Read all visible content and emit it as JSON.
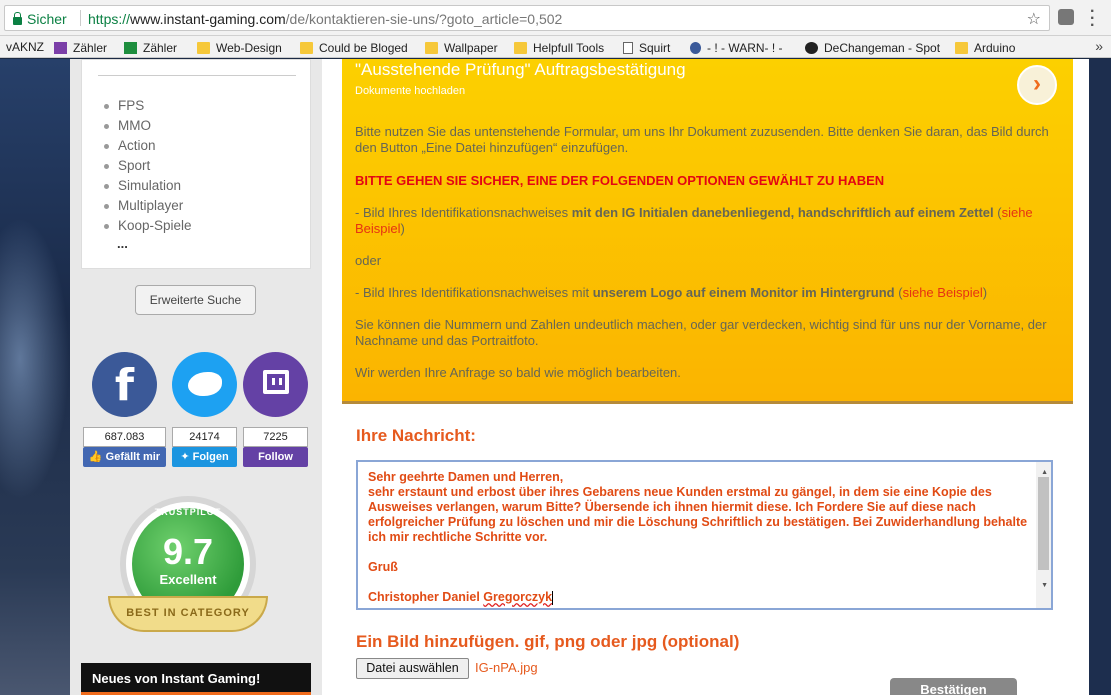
{
  "browser": {
    "secure_label": "Sicher",
    "url_scheme": "https://",
    "url_host": "www.instant-gaming.com",
    "url_path": "/de/kontaktieren-sie-uns/?goto_article=0,502",
    "bookmarks": [
      "vAKNZ",
      "Zähler",
      "Zähler",
      "Web-Design",
      "Could be Bloged",
      "Wallpaper",
      "Helpfull Tools",
      "Squirt",
      "- ! - WARN- ! -",
      "DeChangeman - Spot",
      "Arduino"
    ]
  },
  "sidebar": {
    "categories": [
      "FPS",
      "MMO",
      "Action",
      "Sport",
      "Simulation",
      "Multiplayer",
      "Koop-Spiele"
    ],
    "more": "...",
    "advanced_search": "Erweiterte Suche",
    "facebook": {
      "count": "687.083",
      "label": "Gefällt mir"
    },
    "twitter": {
      "count": "24174",
      "label": "Folgen"
    },
    "twitch": {
      "count": "7225",
      "label": "Follow"
    },
    "trustpilot": {
      "label": "TRUSTPILOT",
      "score": "9.7",
      "rating": "Excellent",
      "ribbon": "BEST IN CATEGORY"
    },
    "news": "Neues von Instant Gaming!"
  },
  "main": {
    "title": "\"Ausstehende Prüfung\" Auftragsbestätigung",
    "subtitle": "Dokumente hochladen",
    "intro": "Bitte nutzen Sie das untenstehende Formular, um uns Ihr Dokument zuzusenden. Bitte denken Sie daran, das Bild durch den Button „Eine Datei hinzufügen“ einzufügen.",
    "warning": "BITTE GEHEN SIE SICHER, EINE DER FOLGENDEN OPTIONEN GEWÄHLT ZU HABEN",
    "option1_pre": "- Bild Ihres Identifikationsnachweises ",
    "option1_bold": "mit den IG Initialen danebenliegend, handschriftlich auf einem Zettel",
    "option1_paren_open": " (",
    "option1_link": "siehe Beispiel",
    "option1_paren_close": ")",
    "or": "oder",
    "option2_pre": "- Bild Ihres Identifikationsnachweises mit ",
    "option2_bold": "unserem Logo auf einem Monitor im Hintergrund",
    "option2_paren_open": " (",
    "option2_link": "siehe Beispiel",
    "option2_paren_close": ")",
    "privacy": "Sie können die Nummern und Zahlen undeutlich machen, oder gar verdecken, wichtig sind für uns nur der Vorname, der Nachname und das Portraitfoto.",
    "closing": "Wir werden Ihre Anfrage so bald wie möglich bearbeiten.",
    "message_label": "Ihre Nachricht:",
    "message_text": "Sehr geehrte Damen und Herren,\nsehr erstaunt und erbost über ihres Gebarens neue Kunden erstmal zu gängel, in dem sie eine Kopie des Ausweises verlangen, warum Bitte? Übersende ich ihnen hiermit diese. Ich Fordere Sie auf diese nach erfolgreicher Prüfung zu löschen und mir die Löschung Schriftlich zu bestätigen. Bei Zuwiderhandlung behalte ich mir rechtliche Schritte vor.\n\nGruß\n\nChristopher Daniel ",
    "message_signature": "Gregorczyk",
    "image_label": "Ein Bild hinzufügen. gif, png oder jpg (optional)",
    "file_button": "Datei auswählen",
    "file_name": "IG-nPA.jpg",
    "submit": "Bestätigen"
  }
}
